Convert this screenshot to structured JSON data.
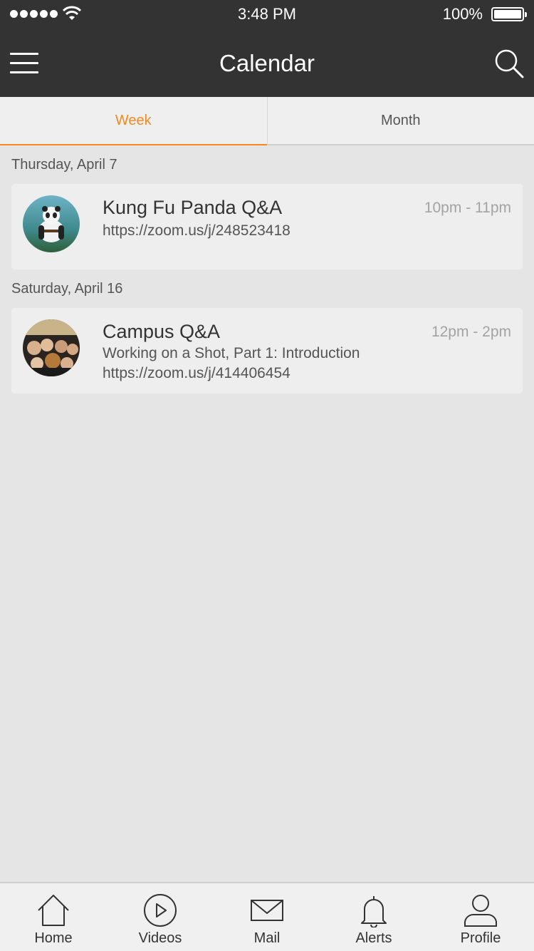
{
  "status_bar": {
    "time": "3:48 PM",
    "battery": "100%"
  },
  "nav": {
    "title": "Calendar",
    "menu_icon": "hamburger-menu-icon",
    "search_icon": "search-icon"
  },
  "tabs": [
    {
      "label": "Week",
      "active": true
    },
    {
      "label": "Month",
      "active": false
    }
  ],
  "sections": [
    {
      "date": "Thursday, April 7",
      "events": [
        {
          "title": "Kung Fu Panda Q&A",
          "time": "10pm - 11pm",
          "lines": [
            "https://zoom.us/j/248523418"
          ]
        }
      ]
    },
    {
      "date": "Saturday, April 16",
      "events": [
        {
          "title": "Campus Q&A",
          "time": "12pm - 2pm",
          "lines": [
            "Working on a Shot, Part 1: Introduction",
            "https://zoom.us/j/414406454"
          ]
        }
      ]
    }
  ],
  "bottom_nav": [
    {
      "label": "Home",
      "icon": "home-icon"
    },
    {
      "label": "Videos",
      "icon": "play-circle-icon"
    },
    {
      "label": "Mail",
      "icon": "mail-icon"
    },
    {
      "label": "Alerts",
      "icon": "bell-icon"
    },
    {
      "label": "Profile",
      "icon": "person-icon"
    }
  ],
  "colors": {
    "accent": "#f08a24",
    "topbar": "#333333",
    "background": "#e5e5e5"
  }
}
